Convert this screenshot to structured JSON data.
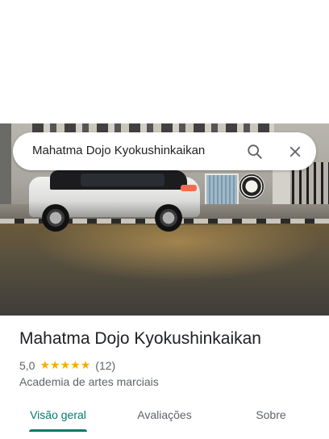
{
  "search": {
    "query": "Mahatma Dojo Kyokushinkaikan",
    "search_icon": "search-icon",
    "close_icon": "close-icon"
  },
  "photo": {
    "description_icon": "street-photo"
  },
  "place": {
    "name": "Mahatma Dojo Kyokushinkaikan",
    "rating": "5,0",
    "stars": [
      "★",
      "★",
      "★",
      "★",
      "★"
    ],
    "review_count": "(12)",
    "category": "Academia de artes marciais"
  },
  "tabs": [
    {
      "label": "Visão geral",
      "active": true
    },
    {
      "label": "Avaliações",
      "active": false
    },
    {
      "label": "Sobre",
      "active": false
    }
  ],
  "colors": {
    "accent": "#00796b",
    "star": "#f9ab00",
    "text_primary": "#202124",
    "text_secondary": "#5f6368"
  }
}
